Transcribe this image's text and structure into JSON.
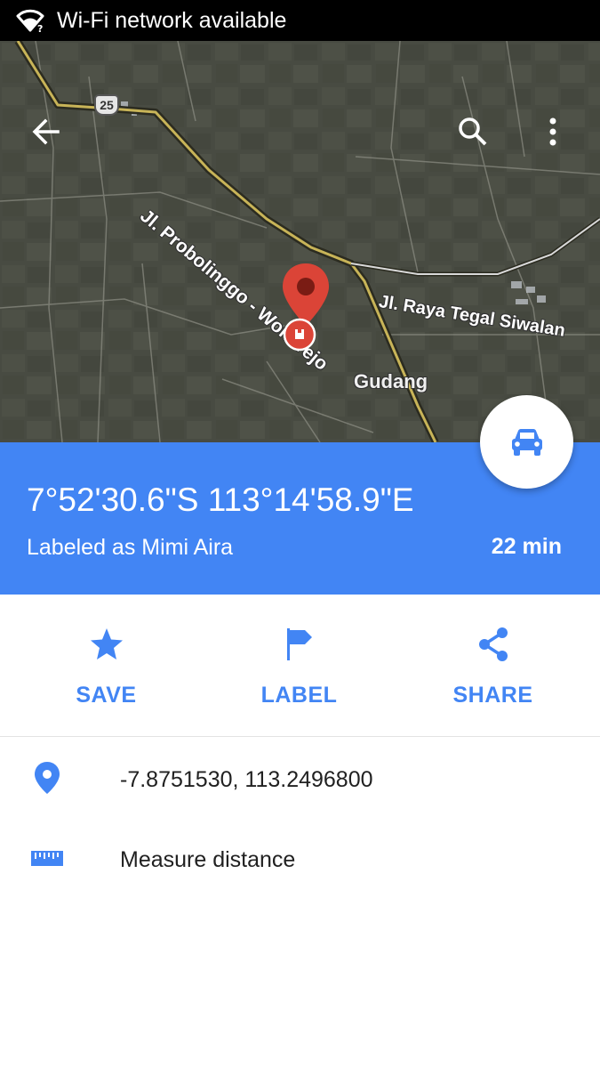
{
  "status_bar": {
    "text": "Wi-Fi network available",
    "icon": "wifi-question-icon"
  },
  "map": {
    "labels": {
      "road_probolinggo": "Jl. Probolinggo - Wonorejo",
      "road_tegal": "Jl. Raya Tegal Siwalan",
      "place_gudang": "Gudang",
      "route_shield": "25"
    },
    "icons": {
      "back": "arrow-back-icon",
      "search": "search-icon",
      "more": "more-vert-icon",
      "pin": "map-pin-icon"
    }
  },
  "place": {
    "title": "7°52'30.6\"S 113°14'58.9\"E",
    "subtitle": "Labeled as Mimi Aira",
    "eta": "22 min",
    "directions_icon": "car-icon"
  },
  "actions": [
    {
      "label": "SAVE",
      "icon": "star-icon"
    },
    {
      "label": "LABEL",
      "icon": "flag-icon"
    },
    {
      "label": "SHARE",
      "icon": "share-icon"
    }
  ],
  "details": {
    "coordinates": "-7.8751530, 113.2496800",
    "measure": "Measure distance"
  },
  "colors": {
    "accent": "#4285f4",
    "status_bar": "#000000",
    "pin": "#db4437"
  }
}
